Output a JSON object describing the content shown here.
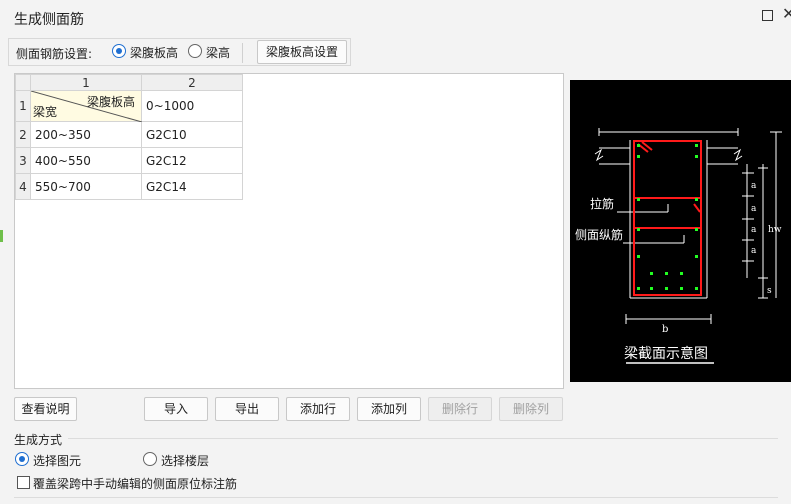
{
  "window": {
    "title": "生成侧面筋"
  },
  "side_rebar_setting": {
    "label": "侧面钢筋设置:",
    "options": [
      {
        "label": "梁腹板高",
        "checked": true
      },
      {
        "label": "梁高",
        "checked": false
      }
    ],
    "settings_button": "梁腹板高设置"
  },
  "grid": {
    "column_headers": [
      "1",
      "2"
    ],
    "header_cell": {
      "top_label": "梁腹板高",
      "bottom_label": "梁宽"
    },
    "header_range": "0~1000",
    "rows": [
      {
        "row": "1"
      },
      {
        "row": "2",
        "width": "200~350",
        "rebar": "G2C10"
      },
      {
        "row": "3",
        "width": "400~550",
        "rebar": "G2C12"
      },
      {
        "row": "4",
        "width": "550~700",
        "rebar": "G2C14"
      }
    ]
  },
  "figure": {
    "caption": "梁截面示意图",
    "tie_label": "拉筋",
    "side_rebar_label": "侧面纵筋",
    "dim_a": "a",
    "dim_hw": "hw",
    "dim_s": "s",
    "dim_b": "b",
    "colors": {
      "background": "#000000",
      "rebar": "#ff1a1a",
      "bars": "#22ff22",
      "lines": "#ffffff"
    }
  },
  "actions": {
    "view_help": "查看说明",
    "import": "导入",
    "export": "导出",
    "add_row": "添加行",
    "add_col": "添加列",
    "delete_row": "删除行",
    "delete_col": "删除列"
  },
  "generate_method": {
    "label": "生成方式",
    "options": [
      {
        "label": "选择图元",
        "checked": true
      },
      {
        "label": "选择楼层",
        "checked": false
      }
    ],
    "overwrite_checkbox": {
      "label": "覆盖梁跨中手动编辑的侧面原位标注筋",
      "checked": false
    }
  },
  "accent_color": "#1f6fd1"
}
